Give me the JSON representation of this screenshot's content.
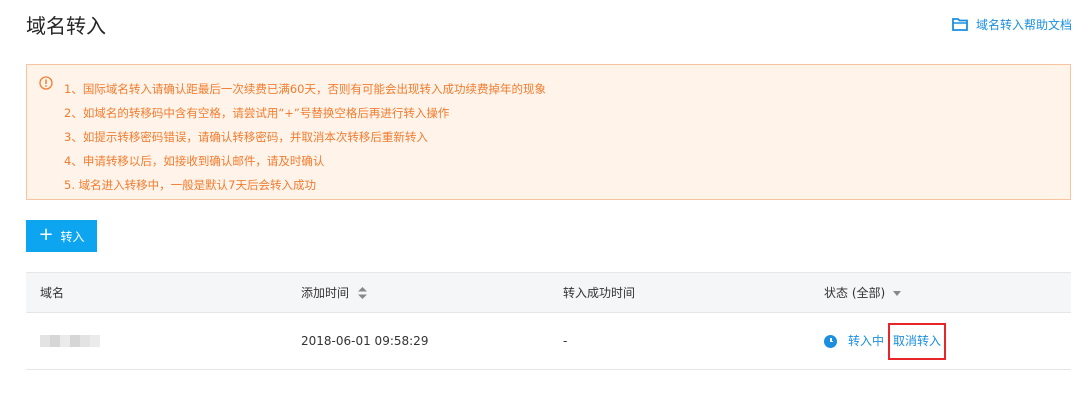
{
  "page": {
    "title": "域名转入",
    "help_link": "域名转入帮助文档"
  },
  "notice": {
    "items": [
      "1、国际域名转入请确认距最后一次续费已满60天，否则有可能会出现转入成功续费掉年的现象",
      "2、如域名的转移码中含有空格，请尝试用“+”号替换空格后再进行转入操作",
      "3、如提示转移密码错误，请确认转移密码，并取消本次转移后重新转入",
      "4、申请转移以后，如接收到确认邮件，请及时确认",
      "5. 域名进入转移中，一般是默认7天后会转入成功"
    ]
  },
  "toolbar": {
    "transfer_button": "转入"
  },
  "table": {
    "headers": {
      "domain": "域名",
      "added_time": "添加时间",
      "success_time": "转入成功时间",
      "status": "状态 (全部)"
    },
    "rows": [
      {
        "domain": "",
        "added_time": "2018-06-01 09:58:29",
        "success_time": "-",
        "status": "转入中",
        "action": "取消转入"
      }
    ]
  },
  "icons": {
    "help": "folder-icon",
    "notice": "warning-circle-icon",
    "add": "plus-icon",
    "sort": "sort-icon",
    "filter": "caret-down-icon",
    "status": "clock-icon"
  },
  "colors": {
    "accent": "#1a8fe0",
    "button": "#0ea5f0",
    "notice_text": "#f27c2e",
    "notice_bg": "#fff3ea",
    "highlight_border": "#e8262a"
  }
}
